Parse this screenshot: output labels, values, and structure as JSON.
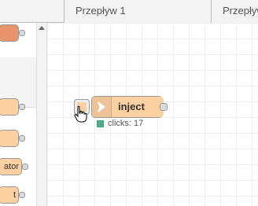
{
  "tabs": [
    {
      "label": "Przepływ 1"
    },
    {
      "label": "Przepływ"
    }
  ],
  "palette": {
    "items": [
      {
        "label": ""
      },
      {
        "label": ""
      },
      {
        "label": ""
      },
      {
        "label": "ator"
      },
      {
        "label": "t"
      }
    ]
  },
  "node": {
    "label": "inject",
    "status": "clicks: 17",
    "colors": {
      "body": "#fdd0a2",
      "status": "#55aa88"
    },
    "icon": "arrow-icon"
  }
}
